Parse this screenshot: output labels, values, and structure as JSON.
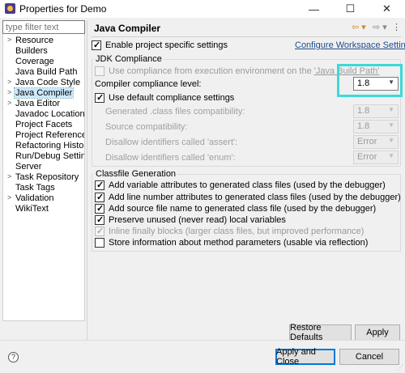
{
  "window": {
    "title": "Properties for Demo",
    "minimize": "—",
    "maximize": "☐",
    "close": "✕"
  },
  "filter": {
    "placeholder": "type filter text"
  },
  "tree": [
    {
      "label": "Resource",
      "arrow": ">"
    },
    {
      "label": "Builders",
      "arrow": ""
    },
    {
      "label": "Coverage",
      "arrow": ""
    },
    {
      "label": "Java Build Path",
      "arrow": ""
    },
    {
      "label": "Java Code Style",
      "arrow": ">"
    },
    {
      "label": "Java Compiler",
      "arrow": ">",
      "selected": true
    },
    {
      "label": "Java Editor",
      "arrow": ">"
    },
    {
      "label": "Javadoc Location",
      "arrow": ""
    },
    {
      "label": "Project Facets",
      "arrow": ""
    },
    {
      "label": "Project References",
      "arrow": ""
    },
    {
      "label": "Refactoring History",
      "arrow": ""
    },
    {
      "label": "Run/Debug Settings",
      "arrow": ""
    },
    {
      "label": "Server",
      "arrow": ""
    },
    {
      "label": "Task Repository",
      "arrow": ">"
    },
    {
      "label": "Task Tags",
      "arrow": ""
    },
    {
      "label": "Validation",
      "arrow": ">"
    },
    {
      "label": "WikiText",
      "arrow": ""
    }
  ],
  "page": {
    "title": "Java Compiler",
    "back": "⇦ ▾",
    "forward": "⇨ ▾",
    "menu": "⋮",
    "enable_project_specific": "Enable project specific settings",
    "configure_workspace": "Configure Workspace Settings..."
  },
  "jdk": {
    "group_label": "JDK Compliance",
    "use_ee_prefix": "Use compliance from execution environment on the ",
    "use_ee_link": "'Java Build Path'",
    "compliance_level_label": "Compiler compliance level:",
    "compliance_level_value": "1.8",
    "use_default": "Use default compliance settings",
    "generated_label": "Generated .class files compatibility:",
    "generated_value": "1.8",
    "source_label": "Source compatibility:",
    "source_value": "1.8",
    "assert_label": "Disallow identifiers called 'assert':",
    "assert_value": "Error",
    "enum_label": "Disallow identifiers called 'enum':",
    "enum_value": "Error"
  },
  "classfile": {
    "group_label": "Classfile Generation",
    "opt1": "Add variable attributes to generated class files (used by the debugger)",
    "opt2": "Add line number attributes to generated class files (used by the debugger)",
    "opt3": "Add source file name to generated class file (used by the debugger)",
    "opt4": "Preserve unused (never read) local variables",
    "opt5": "Inline finally blocks (larger class files, but improved performance)",
    "opt6": "Store information about method parameters (usable via reflection)"
  },
  "buttons": {
    "restore_defaults": "Restore Defaults",
    "apply": "Apply",
    "apply_and_close": "Apply and Close",
    "cancel": "Cancel",
    "help": "?"
  },
  "colors": {
    "highlight": "#3dd8d8",
    "link": "#1f4c90",
    "selection": "#cce8ff"
  }
}
